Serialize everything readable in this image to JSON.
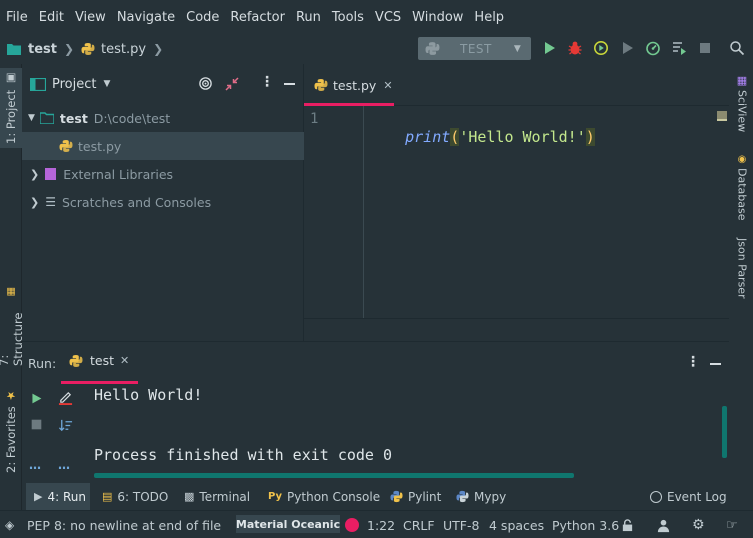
{
  "menu": [
    "File",
    "Edit",
    "View",
    "Navigate",
    "Code",
    "Refactor",
    "Run",
    "Tools",
    "VCS",
    "Window",
    "Help"
  ],
  "breadcrumb": {
    "project": "test",
    "file": "test.py"
  },
  "run_config": {
    "label": "TEST"
  },
  "left_strip": {
    "project_tab": "1: Project",
    "structure_tab": "7: Structure",
    "favorites_tab": "2: Favorites"
  },
  "right_strip": {
    "sciview": "SciView",
    "database": "Database",
    "json_parser": "Json Parser"
  },
  "project_panel": {
    "title": "Project",
    "root_name": "test",
    "root_path": "D:\\code\\test",
    "file": "test.py",
    "external_libraries": "External Libraries",
    "scratches": "Scratches and Consoles"
  },
  "editor": {
    "tab_label": "test.py",
    "line_number": "1",
    "code": {
      "func": "print",
      "open": "(",
      "string": "'Hello World!'",
      "close": ")"
    }
  },
  "run": {
    "label": "Run:",
    "tab_label": "test",
    "output_line1": "Hello World!",
    "output_line2": "Process finished with exit code 0"
  },
  "tool_tabs": {
    "run": "4: Run",
    "todo": "6: TODO",
    "terminal": "Terminal",
    "python_console": "Python Console",
    "pylint": "Pylint",
    "mypy": "Mypy",
    "event_log": "Event Log"
  },
  "status": {
    "pep8": "PEP 8: no newline at end of file",
    "theme": "Material Oceanic",
    "position": "1:22",
    "line_sep": "CRLF",
    "encoding": "UTF-8",
    "indent": "4 spaces",
    "interpreter": "Python 3.6"
  },
  "colors": {
    "accent": "#e91e63",
    "background": "#263238",
    "run_green": "#73c991",
    "debug_red": "#e53935",
    "python_yellow": "#f0c24b",
    "python_blue": "#5d88c7",
    "string_green": "#c3e88d",
    "keyword_italic": "#82aaff"
  }
}
